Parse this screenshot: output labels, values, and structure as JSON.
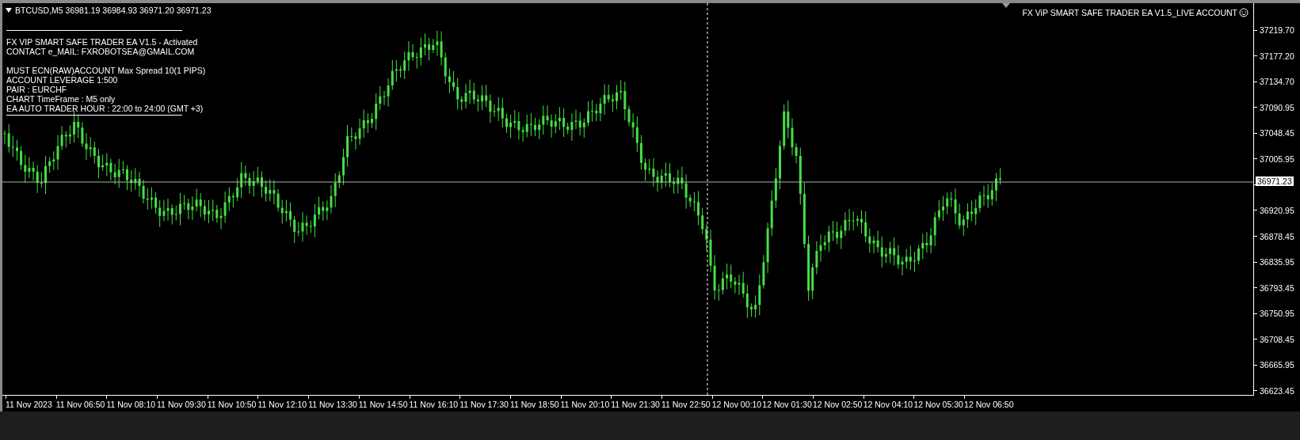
{
  "chart": {
    "header": "BTCUSD,M5  36981.19 36984.93 36971.20 36971.23",
    "info_groups": [
      [
        "FX VIP SMART SAFE TRADER EA V1.5 - Activated",
        "CONTACT e_MAIL: FXROBOTSEA@GMAIL.COM"
      ],
      [
        "MUST ECN(RAW)ACCOUNT Max Spread 10(1 PIPS)",
        "ACCOUNT LEVERAGE 1:500",
        "PAIR : EURCHF",
        "CHART TimeFrame : M5 only",
        "EA AUTO TRADER HOUR : 22:00 to 24:00 (GMT +3)"
      ]
    ],
    "ea_title": "FX ViP SMART SAFE TRADER EA V1.5_LIVE ACCOUNT",
    "bid_label": "36971.23"
  },
  "price_axis": {
    "above_bid": [
      "37219.70",
      "37177.20",
      "37134.70",
      "37090.95",
      "37048.45",
      "37005.95"
    ],
    "below_bid": [
      "36920.95",
      "36878.45",
      "36835.95",
      "36793.45",
      "36750.95",
      "36708.45",
      "36665.95",
      "36623.45"
    ]
  },
  "time_axis": [
    "11 Nov 2023",
    "11 Nov 06:50",
    "11 Nov 08:10",
    "11 Nov 09:30",
    "11 Nov 10:50",
    "11 Nov 12:10",
    "11 Nov 13:30",
    "11 Nov 14:50",
    "11 Nov 16:10",
    "11 Nov 17:30",
    "11 Nov 18:50",
    "11 Nov 20:10",
    "11 Nov 21:30",
    "11 Nov 22:50",
    "12 Nov 00:10",
    "12 Nov 01:30",
    "12 Nov 02:50",
    "12 Nov 04:10",
    "12 Nov 05:30",
    "12 Nov 06:50"
  ]
}
